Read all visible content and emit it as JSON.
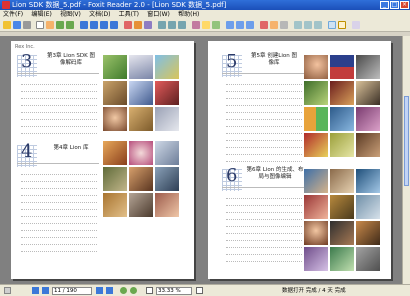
{
  "window": {
    "title": "Lion SDK 数据_5.pdf - Foxit Reader 2.0 - [Lion SDK 数据_5.pdf]",
    "min": "_",
    "max": "□",
    "close": "×"
  },
  "menu": [
    "文件(F)",
    "编辑(E)",
    "视图(V)",
    "文档(D)",
    "工具(T)",
    "窗口(W)",
    "帮助(H)"
  ],
  "pages": [
    {
      "page_label": "Rex Inc.",
      "chapters": [
        {
          "number": "3",
          "title": "第3章 Lion SDK 图\n像解码库"
        },
        {
          "number": "4",
          "title": "第4章 Lion 库"
        }
      ]
    },
    {
      "page_label": "",
      "chapters": [
        {
          "number": "5",
          "title": "第5章 创建Lion 图\n像库"
        },
        {
          "number": "6",
          "title": "第6章 Lion 的生成、布\n局与图像编辑"
        }
      ]
    }
  ],
  "statusbar": {
    "page_field": "11 / 190",
    "zoom_field": "33.33 %",
    "status_text": "数据打开 完成 / 4 天 完成"
  },
  "colors": {
    "titlebar": "#1b4fb9",
    "chrome": "#ece9d8",
    "viewport": "#808080",
    "chapter_number": "#2b3a68"
  }
}
